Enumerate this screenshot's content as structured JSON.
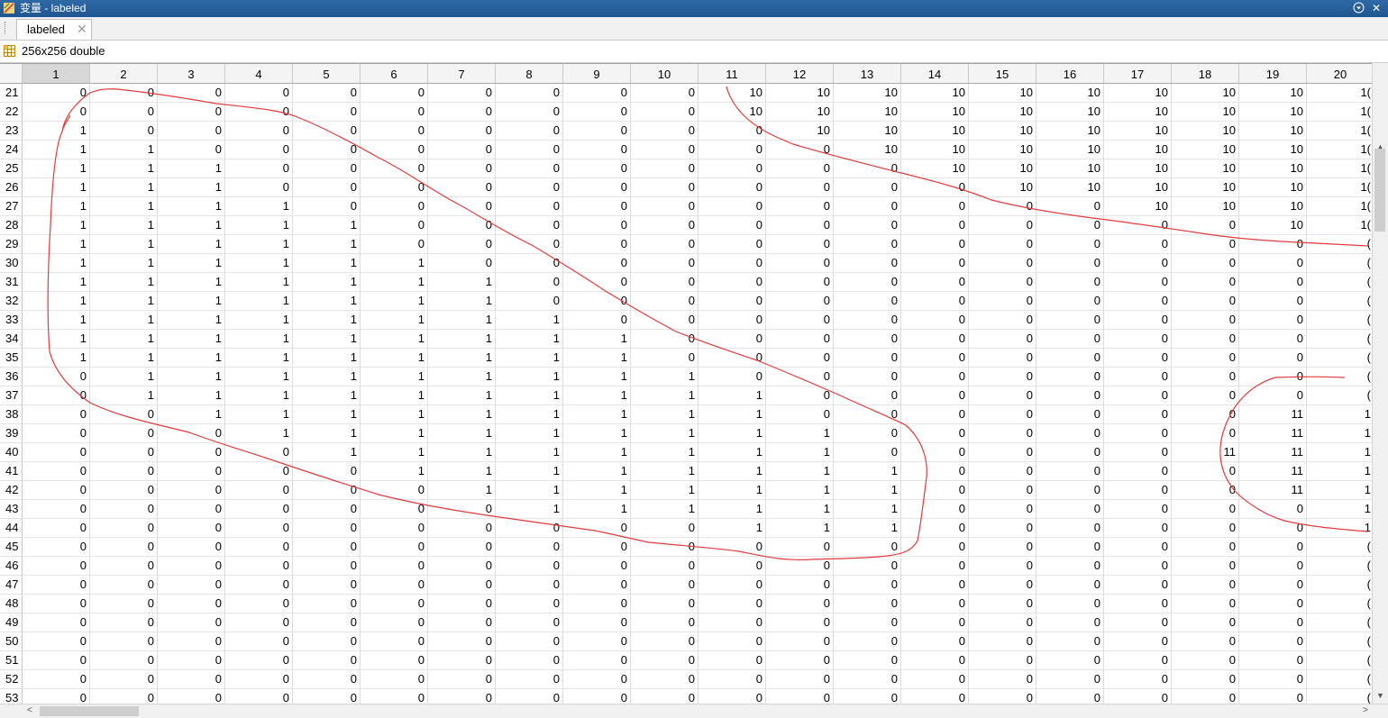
{
  "window": {
    "title": "变量 - labeled",
    "menu_icon": "chevron-down-icon",
    "close_glyph": "✕",
    "menu_glyph": "▾"
  },
  "tab": {
    "label": "labeled",
    "close_glyph": "✕"
  },
  "info": {
    "summary": "256x256 double"
  },
  "grid": {
    "selected_column": 1,
    "columns": [
      "1",
      "2",
      "3",
      "4",
      "5",
      "6",
      "7",
      "8",
      "9",
      "10",
      "11",
      "12",
      "13",
      "14",
      "15",
      "16",
      "17",
      "18",
      "19",
      "20"
    ],
    "rows": [
      {
        "label": "21",
        "cells": [
          "0",
          "0",
          "0",
          "0",
          "0",
          "0",
          "0",
          "0",
          "0",
          "0",
          "10",
          "10",
          "10",
          "10",
          "10",
          "10",
          "10",
          "10",
          "10",
          "1("
        ]
      },
      {
        "label": "22",
        "cells": [
          "0",
          "0",
          "0",
          "0",
          "0",
          "0",
          "0",
          "0",
          "0",
          "0",
          "10",
          "10",
          "10",
          "10",
          "10",
          "10",
          "10",
          "10",
          "10",
          "1("
        ]
      },
      {
        "label": "23",
        "cells": [
          "1",
          "0",
          "0",
          "0",
          "0",
          "0",
          "0",
          "0",
          "0",
          "0",
          "0",
          "10",
          "10",
          "10",
          "10",
          "10",
          "10",
          "10",
          "10",
          "1("
        ]
      },
      {
        "label": "24",
        "cells": [
          "1",
          "1",
          "0",
          "0",
          "0",
          "0",
          "0",
          "0",
          "0",
          "0",
          "0",
          "0",
          "10",
          "10",
          "10",
          "10",
          "10",
          "10",
          "10",
          "1("
        ]
      },
      {
        "label": "25",
        "cells": [
          "1",
          "1",
          "1",
          "0",
          "0",
          "0",
          "0",
          "0",
          "0",
          "0",
          "0",
          "0",
          "0",
          "10",
          "10",
          "10",
          "10",
          "10",
          "10",
          "1("
        ]
      },
      {
        "label": "26",
        "cells": [
          "1",
          "1",
          "1",
          "0",
          "0",
          "0",
          "0",
          "0",
          "0",
          "0",
          "0",
          "0",
          "0",
          "0",
          "10",
          "10",
          "10",
          "10",
          "10",
          "1("
        ]
      },
      {
        "label": "27",
        "cells": [
          "1",
          "1",
          "1",
          "1",
          "0",
          "0",
          "0",
          "0",
          "0",
          "0",
          "0",
          "0",
          "0",
          "0",
          "0",
          "0",
          "10",
          "10",
          "10",
          "1("
        ]
      },
      {
        "label": "28",
        "cells": [
          "1",
          "1",
          "1",
          "1",
          "1",
          "0",
          "0",
          "0",
          "0",
          "0",
          "0",
          "0",
          "0",
          "0",
          "0",
          "0",
          "0",
          "0",
          "10",
          "1("
        ]
      },
      {
        "label": "29",
        "cells": [
          "1",
          "1",
          "1",
          "1",
          "1",
          "0",
          "0",
          "0",
          "0",
          "0",
          "0",
          "0",
          "0",
          "0",
          "0",
          "0",
          "0",
          "0",
          "0",
          "("
        ]
      },
      {
        "label": "30",
        "cells": [
          "1",
          "1",
          "1",
          "1",
          "1",
          "1",
          "0",
          "0",
          "0",
          "0",
          "0",
          "0",
          "0",
          "0",
          "0",
          "0",
          "0",
          "0",
          "0",
          "("
        ]
      },
      {
        "label": "31",
        "cells": [
          "1",
          "1",
          "1",
          "1",
          "1",
          "1",
          "1",
          "0",
          "0",
          "0",
          "0",
          "0",
          "0",
          "0",
          "0",
          "0",
          "0",
          "0",
          "0",
          "("
        ]
      },
      {
        "label": "32",
        "cells": [
          "1",
          "1",
          "1",
          "1",
          "1",
          "1",
          "1",
          "0",
          "0",
          "0",
          "0",
          "0",
          "0",
          "0",
          "0",
          "0",
          "0",
          "0",
          "0",
          "("
        ]
      },
      {
        "label": "33",
        "cells": [
          "1",
          "1",
          "1",
          "1",
          "1",
          "1",
          "1",
          "1",
          "0",
          "0",
          "0",
          "0",
          "0",
          "0",
          "0",
          "0",
          "0",
          "0",
          "0",
          "("
        ]
      },
      {
        "label": "34",
        "cells": [
          "1",
          "1",
          "1",
          "1",
          "1",
          "1",
          "1",
          "1",
          "1",
          "0",
          "0",
          "0",
          "0",
          "0",
          "0",
          "0",
          "0",
          "0",
          "0",
          "("
        ]
      },
      {
        "label": "35",
        "cells": [
          "1",
          "1",
          "1",
          "1",
          "1",
          "1",
          "1",
          "1",
          "1",
          "0",
          "0",
          "0",
          "0",
          "0",
          "0",
          "0",
          "0",
          "0",
          "0",
          "("
        ]
      },
      {
        "label": "36",
        "cells": [
          "0",
          "1",
          "1",
          "1",
          "1",
          "1",
          "1",
          "1",
          "1",
          "1",
          "0",
          "0",
          "0",
          "0",
          "0",
          "0",
          "0",
          "0",
          "0",
          "("
        ]
      },
      {
        "label": "37",
        "cells": [
          "0",
          "1",
          "1",
          "1",
          "1",
          "1",
          "1",
          "1",
          "1",
          "1",
          "1",
          "0",
          "0",
          "0",
          "0",
          "0",
          "0",
          "0",
          "0",
          "("
        ]
      },
      {
        "label": "38",
        "cells": [
          "0",
          "0",
          "1",
          "1",
          "1",
          "1",
          "1",
          "1",
          "1",
          "1",
          "1",
          "0",
          "0",
          "0",
          "0",
          "0",
          "0",
          "0",
          "11",
          "1"
        ]
      },
      {
        "label": "39",
        "cells": [
          "0",
          "0",
          "0",
          "1",
          "1",
          "1",
          "1",
          "1",
          "1",
          "1",
          "1",
          "1",
          "0",
          "0",
          "0",
          "0",
          "0",
          "0",
          "11",
          "1"
        ]
      },
      {
        "label": "40",
        "cells": [
          "0",
          "0",
          "0",
          "0",
          "1",
          "1",
          "1",
          "1",
          "1",
          "1",
          "1",
          "1",
          "0",
          "0",
          "0",
          "0",
          "0",
          "11",
          "11",
          "1"
        ]
      },
      {
        "label": "41",
        "cells": [
          "0",
          "0",
          "0",
          "0",
          "0",
          "1",
          "1",
          "1",
          "1",
          "1",
          "1",
          "1",
          "1",
          "0",
          "0",
          "0",
          "0",
          "0",
          "11",
          "1"
        ]
      },
      {
        "label": "42",
        "cells": [
          "0",
          "0",
          "0",
          "0",
          "0",
          "0",
          "1",
          "1",
          "1",
          "1",
          "1",
          "1",
          "1",
          "0",
          "0",
          "0",
          "0",
          "0",
          "11",
          "1"
        ]
      },
      {
        "label": "43",
        "cells": [
          "0",
          "0",
          "0",
          "0",
          "0",
          "0",
          "0",
          "1",
          "1",
          "1",
          "1",
          "1",
          "1",
          "0",
          "0",
          "0",
          "0",
          "0",
          "0",
          "1"
        ]
      },
      {
        "label": "44",
        "cells": [
          "0",
          "0",
          "0",
          "0",
          "0",
          "0",
          "0",
          "0",
          "0",
          "0",
          "1",
          "1",
          "1",
          "0",
          "0",
          "0",
          "0",
          "0",
          "0",
          "1"
        ]
      },
      {
        "label": "45",
        "cells": [
          "0",
          "0",
          "0",
          "0",
          "0",
          "0",
          "0",
          "0",
          "0",
          "0",
          "0",
          "0",
          "0",
          "0",
          "0",
          "0",
          "0",
          "0",
          "0",
          "("
        ]
      },
      {
        "label": "46",
        "cells": [
          "0",
          "0",
          "0",
          "0",
          "0",
          "0",
          "0",
          "0",
          "0",
          "0",
          "0",
          "0",
          "0",
          "0",
          "0",
          "0",
          "0",
          "0",
          "0",
          "("
        ]
      },
      {
        "label": "47",
        "cells": [
          "0",
          "0",
          "0",
          "0",
          "0",
          "0",
          "0",
          "0",
          "0",
          "0",
          "0",
          "0",
          "0",
          "0",
          "0",
          "0",
          "0",
          "0",
          "0",
          "("
        ]
      },
      {
        "label": "48",
        "cells": [
          "0",
          "0",
          "0",
          "0",
          "0",
          "0",
          "0",
          "0",
          "0",
          "0",
          "0",
          "0",
          "0",
          "0",
          "0",
          "0",
          "0",
          "0",
          "0",
          "("
        ]
      },
      {
        "label": "49",
        "cells": [
          "0",
          "0",
          "0",
          "0",
          "0",
          "0",
          "0",
          "0",
          "0",
          "0",
          "0",
          "0",
          "0",
          "0",
          "0",
          "0",
          "0",
          "0",
          "0",
          "("
        ]
      },
      {
        "label": "50",
        "cells": [
          "0",
          "0",
          "0",
          "0",
          "0",
          "0",
          "0",
          "0",
          "0",
          "0",
          "0",
          "0",
          "0",
          "0",
          "0",
          "0",
          "0",
          "0",
          "0",
          "("
        ]
      },
      {
        "label": "51",
        "cells": [
          "0",
          "0",
          "0",
          "0",
          "0",
          "0",
          "0",
          "0",
          "0",
          "0",
          "0",
          "0",
          "0",
          "0",
          "0",
          "0",
          "0",
          "0",
          "0",
          "("
        ]
      },
      {
        "label": "52",
        "cells": [
          "0",
          "0",
          "0",
          "0",
          "0",
          "0",
          "0",
          "0",
          "0",
          "0",
          "0",
          "0",
          "0",
          "0",
          "0",
          "0",
          "0",
          "0",
          "0",
          "("
        ]
      },
      {
        "label": "53",
        "cells": [
          "0",
          "0",
          "0",
          "0",
          "0",
          "0",
          "0",
          "0",
          "0",
          "0",
          "0",
          "0",
          "0",
          "0",
          "0",
          "0",
          "0",
          "0",
          "0",
          "("
        ]
      }
    ]
  },
  "annotation": {
    "stroke_color": "#e23b3b",
    "description_icon": "freehand-ink-annotation"
  },
  "scroll": {
    "up_glyph": "▲",
    "down_glyph": "▼",
    "left_glyph": "<",
    "right_glyph": ">"
  }
}
